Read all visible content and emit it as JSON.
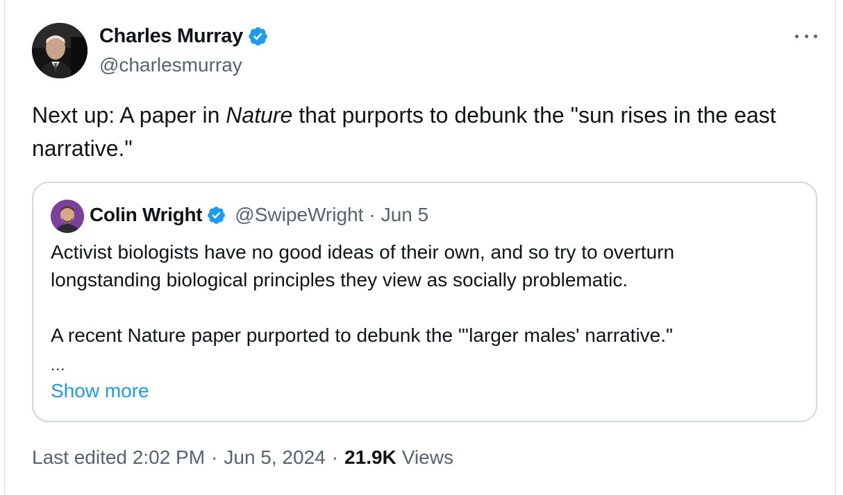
{
  "author": {
    "name": "Charles Murray",
    "handle": "@charlesmurray",
    "verified_icon": "verified-badge-icon"
  },
  "menu_icon": "more-horizontal-icon",
  "tweet": {
    "text_before": "Next up: A paper in ",
    "text_italic": "Nature",
    "text_after": " that purports to debunk the \"sun rises in the east narrative.\""
  },
  "quoted": {
    "name": "Colin Wright",
    "handle": "@SwipeWright",
    "separator": "·",
    "date": "Jun 5",
    "lines": [
      "Activist biologists have no good ideas of their own, and so try to overturn",
      "longstanding biological principles they view as socially problematic.",
      "",
      "A recent Nature paper purported to debunk the \"'larger males' narrative.\""
    ],
    "ellipsis": "...",
    "show_more": "Show more"
  },
  "meta": {
    "edited": "Last edited 2:02 PM",
    "separator": "·",
    "date": "Jun 5, 2024",
    "views_count": "21.9K",
    "views_label": "Views"
  },
  "colors": {
    "text": "#0f1419",
    "secondary": "#536471",
    "link": "#1d9bf0",
    "verified": "#1d9bf0",
    "border": "#cfd9de"
  }
}
